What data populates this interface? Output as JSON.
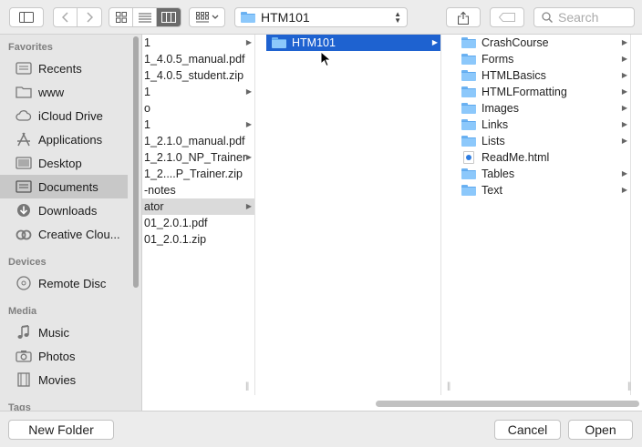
{
  "toolbar": {
    "path_label": "HTM101",
    "search_placeholder": "Search"
  },
  "sidebar": {
    "favorites_header": "Favorites",
    "favorites": [
      {
        "label": "Recents",
        "icon": "recents-icon"
      },
      {
        "label": "www",
        "icon": "folder-icon"
      },
      {
        "label": "iCloud Drive",
        "icon": "cloud-icon"
      },
      {
        "label": "Applications",
        "icon": "applications-icon"
      },
      {
        "label": "Desktop",
        "icon": "desktop-icon"
      },
      {
        "label": "Documents",
        "icon": "documents-icon",
        "selected": true
      },
      {
        "label": "Downloads",
        "icon": "downloads-icon"
      },
      {
        "label": "Creative Clou...",
        "icon": "creative-cloud-icon"
      }
    ],
    "devices_header": "Devices",
    "devices": [
      {
        "label": "Remote Disc",
        "icon": "disc-icon"
      }
    ],
    "media_header": "Media",
    "media": [
      {
        "label": "Music",
        "icon": "music-icon"
      },
      {
        "label": "Photos",
        "icon": "camera-icon"
      },
      {
        "label": "Movies",
        "icon": "film-icon"
      }
    ],
    "tags_header": "Tags"
  },
  "column1": [
    "1",
    "1_4.0.5_manual.pdf",
    "1_4.0.5_student.zip",
    "1",
    "o",
    "1",
    "1_2.1.0_manual.pdf",
    "1_2.1.0_NP_Trainer",
    "1_2....P_Trainer.zip",
    "-notes",
    "ator",
    "01_2.0.1.pdf",
    "01_2.0.1.zip"
  ],
  "column2": [
    "HTM101"
  ],
  "column3": [
    "CrashCourse",
    "Forms",
    "HTMLBasics",
    "HTMLFormatting",
    "Images",
    "Links",
    "Lists",
    "ReadMe.html",
    "Tables",
    "Text"
  ],
  "buttons": {
    "new_folder": "New Folder",
    "cancel": "Cancel",
    "open": "Open"
  },
  "colors": {
    "selection": "#1e62d0",
    "folder": "#8cc8fb"
  }
}
